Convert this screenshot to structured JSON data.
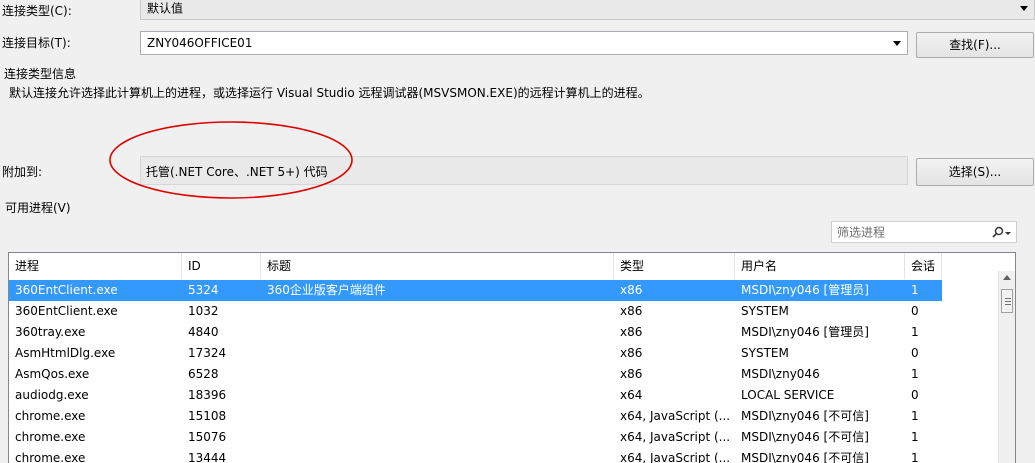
{
  "connection_type": {
    "label": "连接类型(C):",
    "value": "默认值"
  },
  "connection_target": {
    "label": "连接目标(T):",
    "value": "ZNY046OFFICE01",
    "find_button": "查找(F)..."
  },
  "info": {
    "heading": "连接类型信息",
    "text": "默认连接允许选择此计算机上的进程，或选择运行 Visual Studio 远程调试器(MSVSMON.EXE)的远程计算机上的进程。"
  },
  "attach_to": {
    "label": "附加到:",
    "value": "托管(.NET Core、.NET 5+) 代码",
    "select_button": "选择(S)..."
  },
  "processes": {
    "label": "可用进程(V)",
    "filter_placeholder": "筛选进程",
    "columns": [
      "进程",
      "ID",
      "标题",
      "类型",
      "用户名",
      "会话"
    ],
    "rows": [
      {
        "process": "360EntClient.exe",
        "id": "5324",
        "title": "360企业版客户端组件",
        "type": "x86",
        "user": "MSDI\\zny046 [管理员]",
        "session": "1",
        "selected": true
      },
      {
        "process": "360EntClient.exe",
        "id": "1032",
        "title": "",
        "type": "x86",
        "user": "SYSTEM",
        "session": "0"
      },
      {
        "process": "360tray.exe",
        "id": "4840",
        "title": "",
        "type": "x86",
        "user": "MSDI\\zny046 [管理员]",
        "session": "1"
      },
      {
        "process": "AsmHtmlDlg.exe",
        "id": "17324",
        "title": "",
        "type": "x86",
        "user": "SYSTEM",
        "session": "0"
      },
      {
        "process": "AsmQos.exe",
        "id": "6528",
        "title": "",
        "type": "x86",
        "user": "MSDI\\zny046",
        "session": "1"
      },
      {
        "process": "audiodg.exe",
        "id": "18396",
        "title": "",
        "type": "x64",
        "user": "LOCAL SERVICE",
        "session": "0"
      },
      {
        "process": "chrome.exe",
        "id": "15108",
        "title": "",
        "type": "x64, JavaScript (...",
        "user": "MSDI\\zny046 [不可信]",
        "session": "1"
      },
      {
        "process": "chrome.exe",
        "id": "15076",
        "title": "",
        "type": "x64, JavaScript (...",
        "user": "MSDI\\zny046 [不可信]",
        "session": "1"
      },
      {
        "process": "chrome.exe",
        "id": "13444",
        "title": "",
        "type": "x64, JavaScript (...",
        "user": "MSDI\\zny046 [不可信]",
        "session": "1"
      }
    ]
  },
  "annotation_color": "#e00000",
  "selection_color": "#3399ff"
}
